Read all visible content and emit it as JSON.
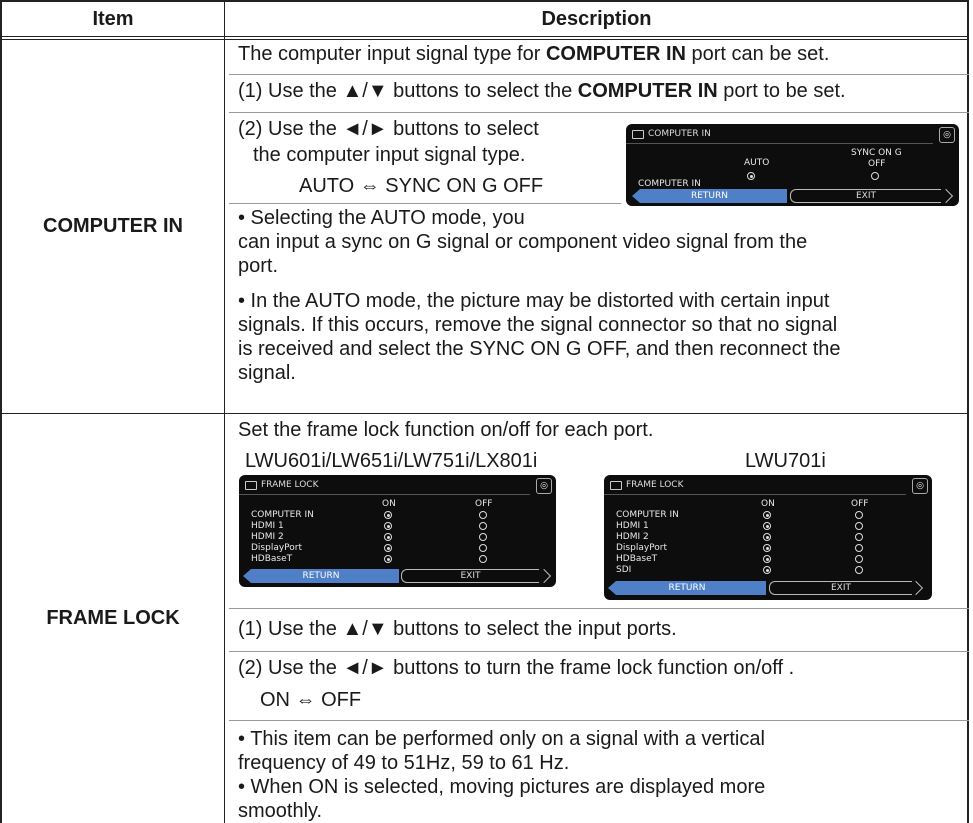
{
  "header": {
    "item": "Item",
    "description": "Description"
  },
  "rows": [
    {
      "item": "COMPUTER IN",
      "intro": {
        "pre": "The computer input signal type for ",
        "bold": "COMPUTER IN",
        "post": " port can be set."
      },
      "step1": {
        "pre": "(1) Use the ▲/▼ buttons to select the ",
        "bold": "COMPUTER IN",
        "post": " port to be set."
      },
      "step2_line1": "(2) Use the ◄/► buttons to select",
      "step2_line2": "the computer input signal type.",
      "options": "AUTO ⇔ SYNC ON G OFF",
      "note1_line1": "• Selecting the AUTO mode, you",
      "note1_line2": "can input a sync on G signal or component video signal from the",
      "note1_line3": "port.",
      "note2_line1": "• In the AUTO mode, the picture may be distorted with certain input",
      "note2_line2": "signals. If this occurs, remove the signal connector so that no signal",
      "note2_line3": "is received and select the SYNC ON G OFF, and then reconnect the",
      "note2_line4": "signal.",
      "osd": {
        "title": "COMPUTER IN",
        "col_auto": "AUTO",
        "col_sync_1": "SYNC ON G",
        "col_sync_2": "OFF",
        "row_label": "COMPUTER IN",
        "selected": "AUTO",
        "return_label": "RETURN",
        "exit_label": "EXIT"
      }
    },
    {
      "item": "FRAME LOCK",
      "intro": "Set the frame lock function on/off for each port.",
      "model_left": "LWU601i/LW651i/LW751i/LX801i",
      "model_right": "LWU701i",
      "osd_left": {
        "title": "FRAME LOCK",
        "col_on": "ON",
        "col_off": "OFF",
        "ports": [
          "COMPUTER IN",
          "HDMI 1",
          "HDMI 2",
          "DisplayPort",
          "HDBaseT"
        ],
        "return_label": "RETURN",
        "exit_label": "EXIT"
      },
      "osd_right": {
        "title": "FRAME LOCK",
        "col_on": "ON",
        "col_off": "OFF",
        "ports": [
          "COMPUTER IN",
          "HDMI 1",
          "HDMI 2",
          "DisplayPort",
          "HDBaseT",
          "SDI"
        ],
        "return_label": "RETURN",
        "exit_label": "EXIT"
      },
      "step1": "(1) Use the ▲/▼ buttons to select the input ports.",
      "step2": "(2) Use the ◄/► buttons to turn the frame lock function on/off .",
      "options": "ON ⇔ OFF",
      "note1_line1": "• This item can be performed only on a signal with a vertical",
      "note1_line2": "frequency of 49 to 51Hz, 59 to 61 Hz.",
      "note2_line1": "• When ON is selected, moving pictures are displayed more",
      "note2_line2": "smoothly."
    }
  ]
}
